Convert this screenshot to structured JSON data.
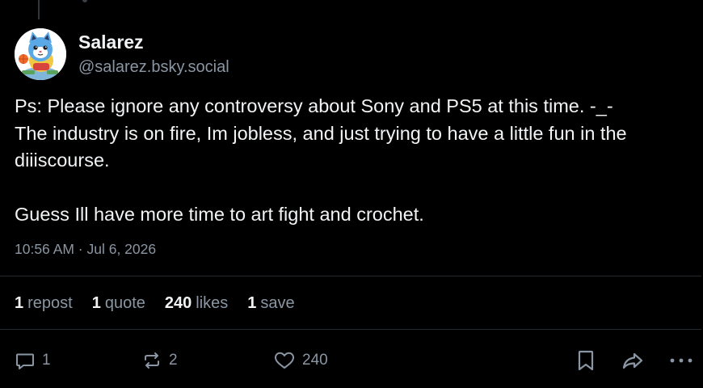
{
  "post": {
    "author": {
      "display_name": "Salarez",
      "handle": "@salarez.bsky.social",
      "avatar_icon": "cat-mascot-avatar"
    },
    "text_lines": [
      "Ps: Please ignore any controversy about Sony and PS5 at this time. -_-",
      "The industry is on fire, Im jobless, and just trying to have a little fun in the diiiscourse.",
      "Guess Ill have more time to art fight and crochet."
    ],
    "timestamp": "10:56 AM · Jul 6, 2026"
  },
  "stats": {
    "reposts": {
      "count": "1",
      "label": "repost"
    },
    "quotes": {
      "count": "1",
      "label": "quote"
    },
    "likes": {
      "count": "240",
      "label": "likes"
    },
    "saves": {
      "count": "1",
      "label": "save"
    }
  },
  "actions": {
    "reply_count": "1",
    "repost_count": "2",
    "like_count": "240",
    "icons": [
      "reply-icon",
      "repost-icon",
      "heart-icon",
      "bookmark-icon",
      "share-icon",
      "more-icon"
    ]
  },
  "colors": {
    "background": "#000000",
    "text_primary": "#f1f3f5",
    "text_secondary": "#8a96a3",
    "divider": "#252a2e"
  }
}
